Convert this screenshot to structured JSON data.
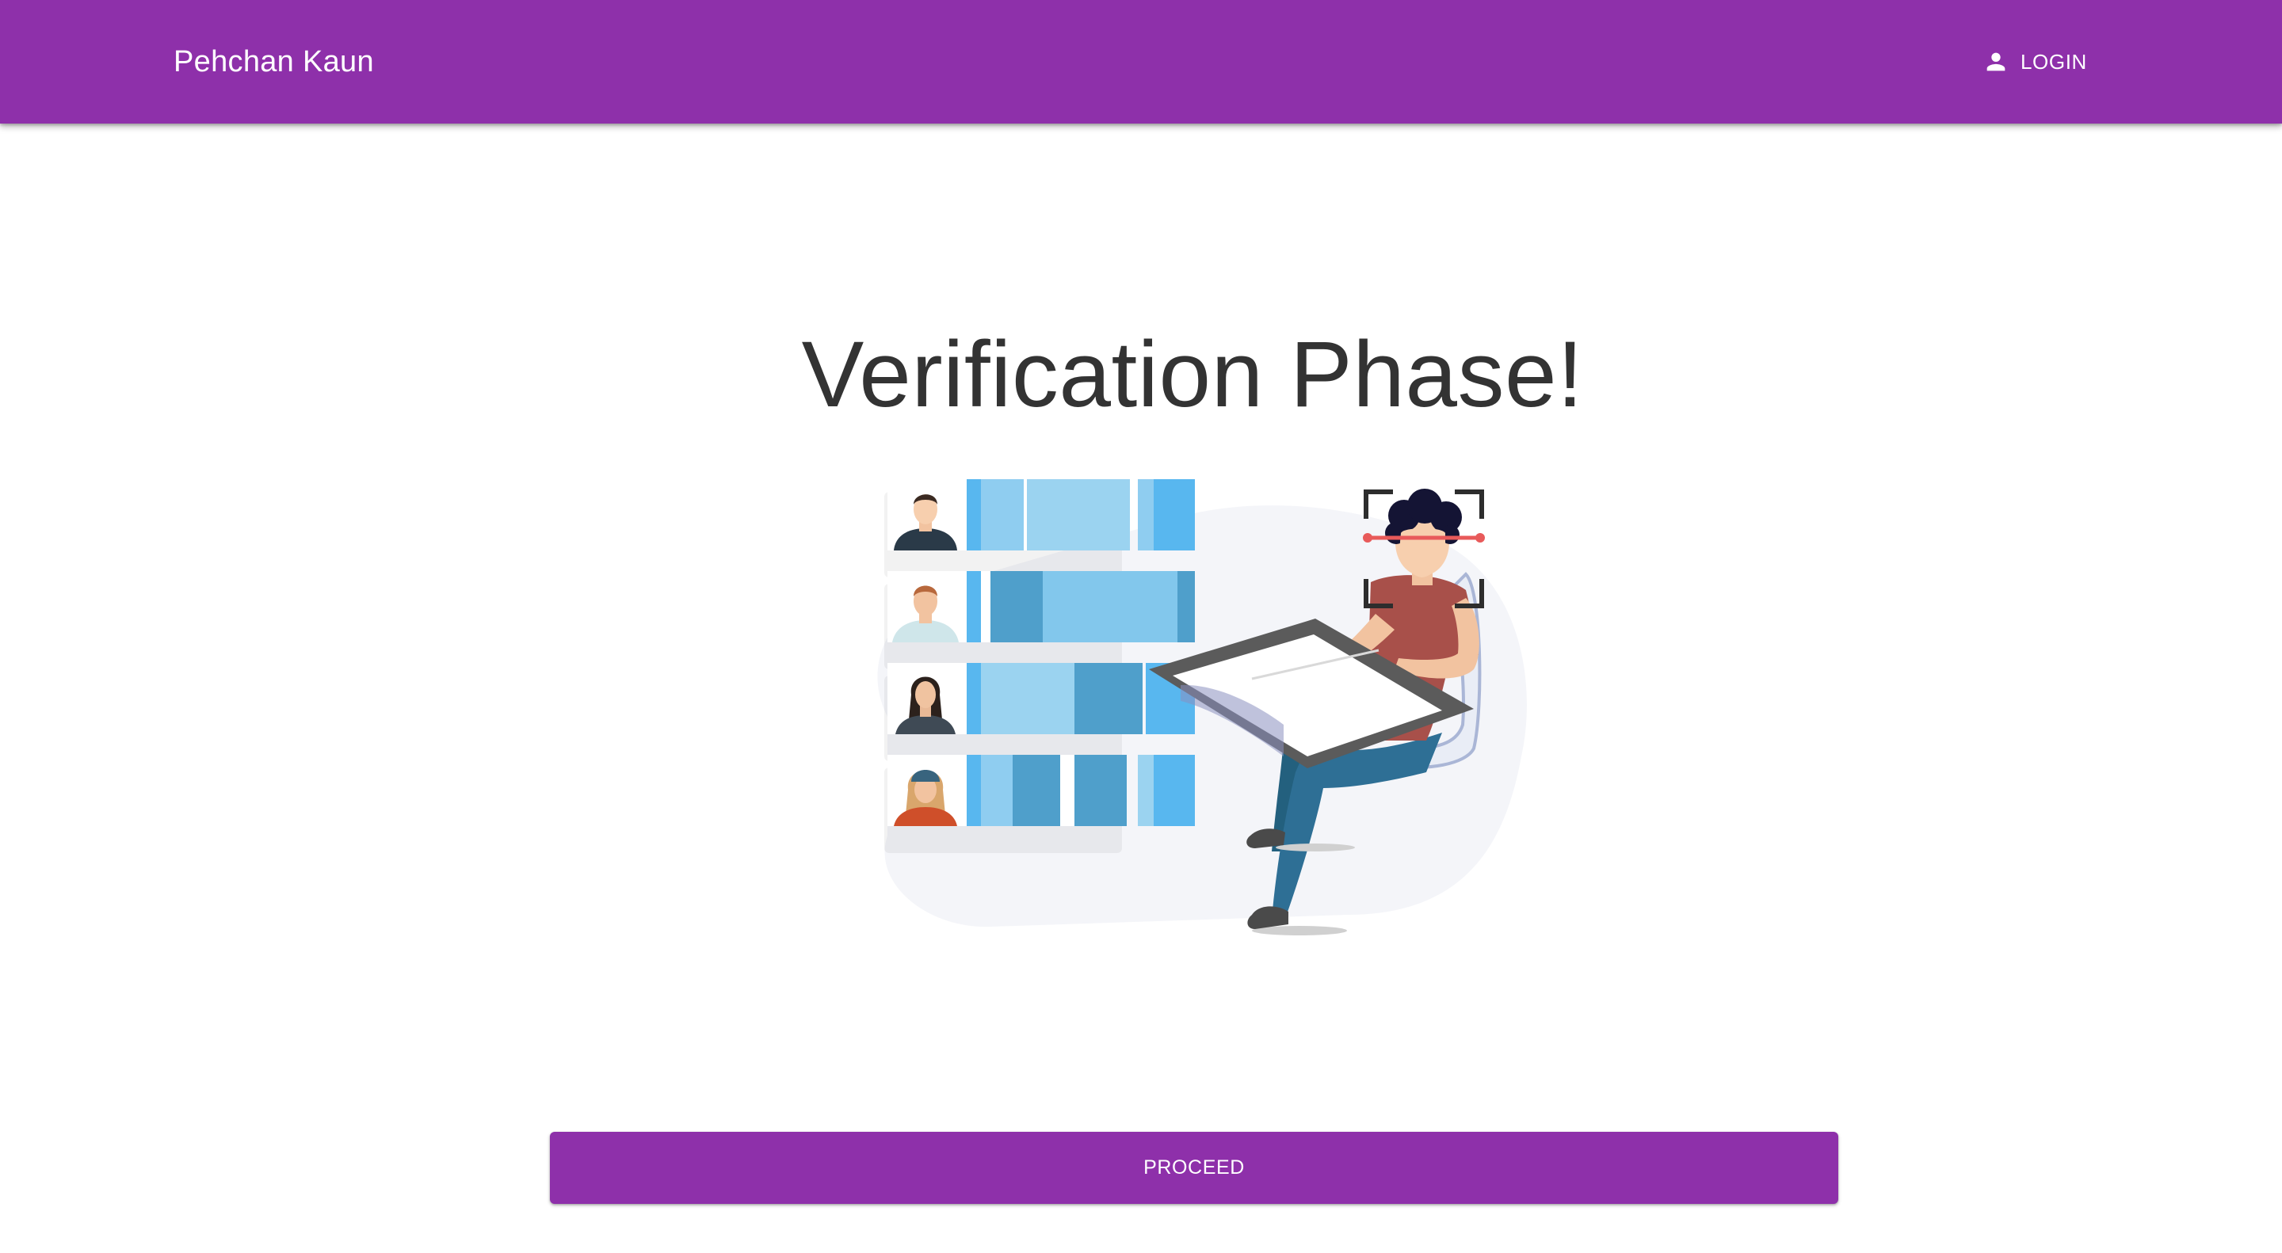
{
  "appbar": {
    "brand": "Pehchan Kaun",
    "login_label": "LOGIN",
    "login_icon": "person-icon",
    "background_color": "#8e30aa"
  },
  "main": {
    "title": "Verification Phase!",
    "illustration": "face-verification-illustration",
    "proceed_label": "PROCEED"
  },
  "colors": {
    "primary": "#8e30aa",
    "title_text": "#333333",
    "bar_light": "#9bd3f0",
    "bar_mid": "#55a3cf",
    "bar_bright": "#58b7ef"
  }
}
